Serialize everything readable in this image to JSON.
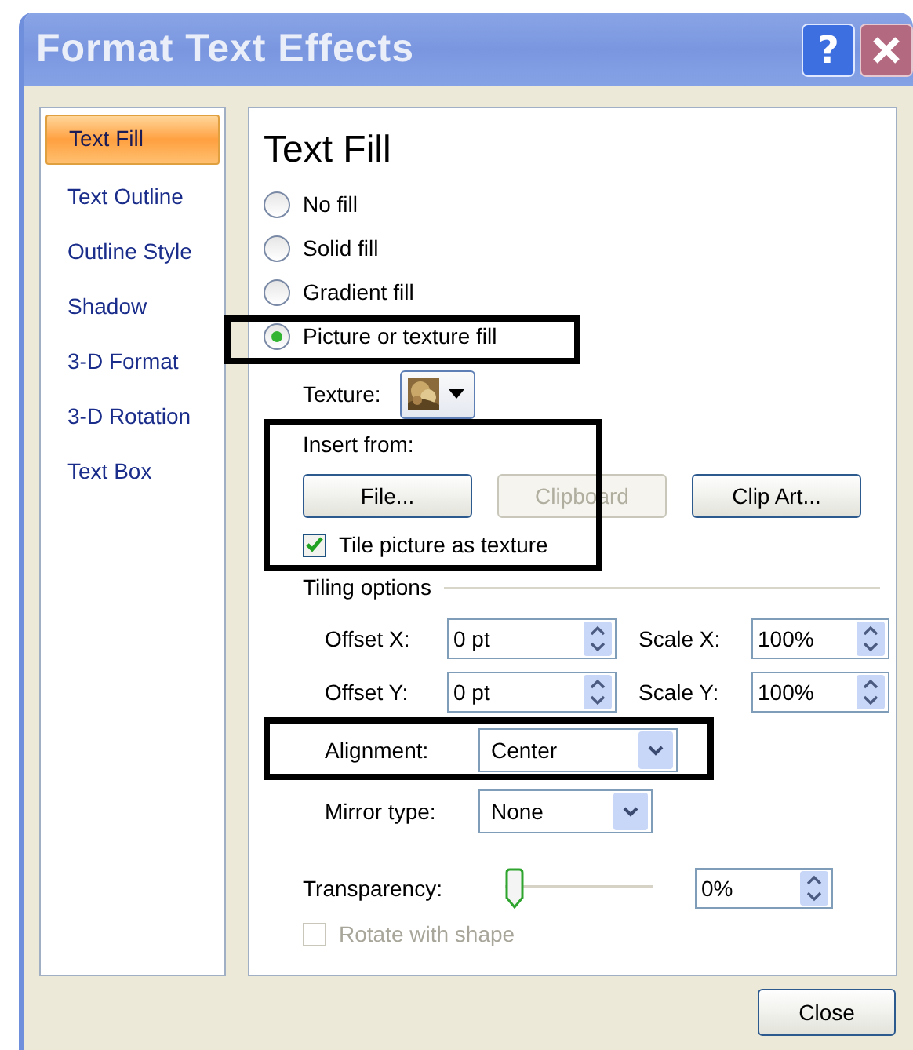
{
  "window": {
    "title": "Format Text Effects",
    "help_label": "?"
  },
  "sidebar": {
    "items": [
      {
        "label": "Text Fill",
        "selected": true
      },
      {
        "label": "Text Outline",
        "selected": false
      },
      {
        "label": "Outline Style",
        "selected": false
      },
      {
        "label": "Shadow",
        "selected": false
      },
      {
        "label": "3-D Format",
        "selected": false
      },
      {
        "label": "3-D Rotation",
        "selected": false
      },
      {
        "label": "Text Box",
        "selected": false
      }
    ]
  },
  "panel": {
    "heading": "Text Fill",
    "fill_options": [
      {
        "label": "No fill",
        "selected": false
      },
      {
        "label": "Solid fill",
        "selected": false
      },
      {
        "label": "Gradient fill",
        "selected": false
      },
      {
        "label": "Picture or texture fill",
        "selected": true,
        "highlighted": true
      }
    ],
    "texture": {
      "label": "Texture:"
    },
    "insert_from": {
      "label": "Insert from:",
      "highlighted": true,
      "buttons": [
        {
          "label": "File...",
          "disabled": false
        },
        {
          "label": "Clipboard",
          "disabled": true
        },
        {
          "label": "Clip Art...",
          "disabled": false
        }
      ],
      "tile": {
        "label": "Tile picture as texture",
        "checked": true
      }
    },
    "tiling_options": {
      "label": "Tiling options",
      "spinners": [
        {
          "label": "Offset X:",
          "value": "0 pt"
        },
        {
          "label": "Scale X:",
          "value": "100%"
        },
        {
          "label": "Offset Y:",
          "value": "0 pt"
        },
        {
          "label": "Scale Y:",
          "value": "100%"
        }
      ],
      "combos": [
        {
          "label": "Alignment:",
          "value": "Center",
          "highlighted": true
        },
        {
          "label": "Mirror type:",
          "value": "None"
        }
      ]
    },
    "transparency": {
      "label": "Transparency:",
      "level": 0,
      "value": "0%"
    },
    "rotate": {
      "label": "Rotate with shape",
      "checked": false,
      "disabled": true
    }
  },
  "buttons": [
    {
      "label": "Close"
    }
  ]
}
